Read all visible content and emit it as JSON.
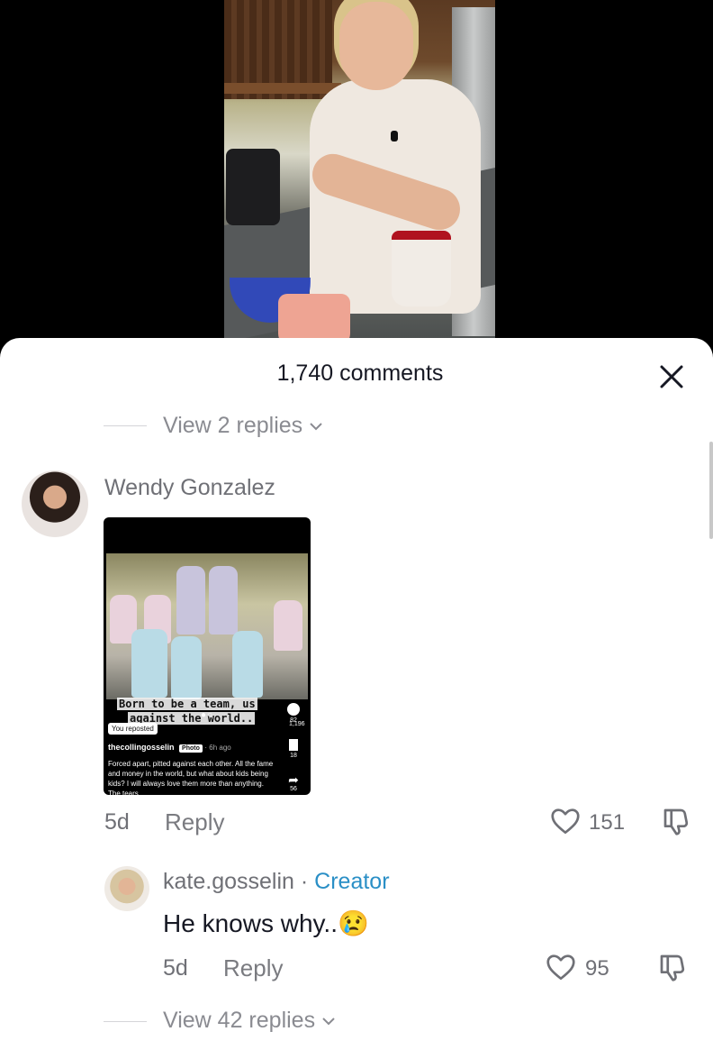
{
  "header": {
    "comment_count": "1,740 comments"
  },
  "thread_top": {
    "view_replies": "View 2 replies"
  },
  "comment1": {
    "username": "Wendy Gonzalez",
    "date": "5d",
    "reply_label": "Reply",
    "likes": "151",
    "attachment": {
      "caption_line1": "Born to be a team, us",
      "caption_line2": "against the world..",
      "likes": "1,196",
      "comments": "82",
      "saves": "18",
      "shares": "56",
      "reposted_badge": "You reposted",
      "user": "thecollingosselin",
      "photo_tag": "Photo",
      "time": "· 6h ago",
      "text": "Forced apart, pitted against each other. All the fame and money in the world, but what about kids being kids? I will always love them more than anything. The tears"
    }
  },
  "reply1": {
    "username": "kate.gosselin",
    "separator": " · ",
    "creator_label": "Creator",
    "text": "He knows why..",
    "emoji": "😢",
    "date": "5d",
    "reply_label": "Reply",
    "likes": "95"
  },
  "thread_bottom": {
    "view_replies": "View 42 replies"
  }
}
